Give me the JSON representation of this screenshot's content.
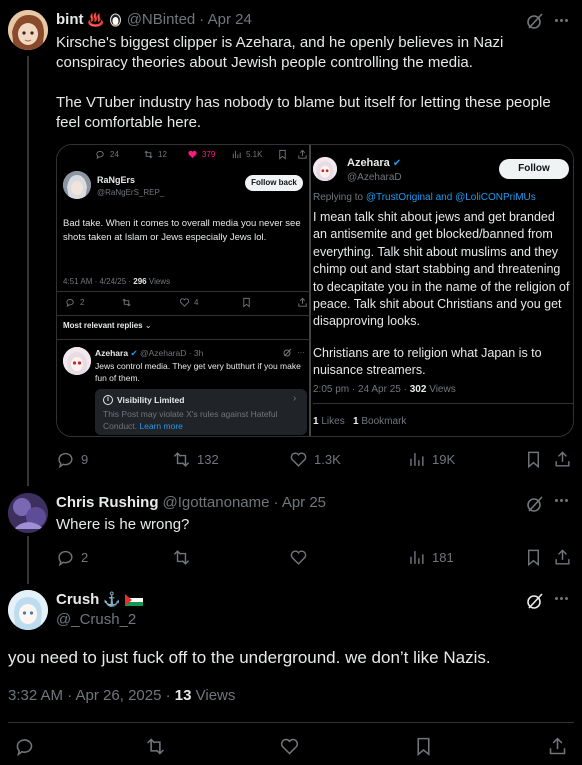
{
  "tweet1": {
    "display_name": "bint",
    "emoji": "♨️",
    "handle": "@NBinted",
    "date": "· Apr 24",
    "text_p1": "Kirsche's biggest clipper is Azehara, and he openly believes in Nazi conspiracy theories about Jewish people controlling the media.",
    "text_p2": "The VTuber industry has nobody to blame but itself for letting these people feel comfortable here.",
    "replies": "9",
    "reposts": "132",
    "likes": "1.3K",
    "views": "19K"
  },
  "embed_left": {
    "top_stats": {
      "replies": "24",
      "reposts": "12",
      "likes": "379",
      "views": "5.1K"
    },
    "name": "RaNgErs",
    "handle": "@RaNgErS_REP_",
    "follow_back": "Follow back",
    "text": "Bad take. When it comes to overall media you never see shots taken at Islam or Jews especially Jews lol.",
    "time": "4:51 AM · 4/24/25 ·",
    "views": "296",
    "views_label": "Views",
    "replies": "2",
    "likes": "4",
    "relevant": "Most relevant replies",
    "reply_name": "Azehara",
    "reply_handle": "@AzeharaD · 3h",
    "reply_text": "Jews control media.  They get very butthurt if you make fun of them.",
    "visibility_title": "Visibility Limited",
    "visibility_text": "This Post may violate X's rules against Hateful Conduct.",
    "learn_more": "Learn more"
  },
  "embed_right": {
    "name": "Azehara",
    "handle": "@AzeharaD",
    "follow": "Follow",
    "replying_prefix": "Replying to",
    "replying_to": "@TrustOriginal and @LoliCONPriMUs",
    "text1": "I mean talk shit about jews and get branded an antisemite and get blocked/banned from everything.  Talk shit about muslims and they chimp out and start stabbing and threatening to decapitate you in the name of the religion of peace.  Talk shit about Christians and you get disapproving looks.",
    "text2": "Christians are to religion what Japan is to nuisance streamers.",
    "time": "2:05 pm · 24 Apr 25 ·",
    "views": "302",
    "views_label": "Views",
    "likes_count": "1",
    "likes_label": "Likes",
    "bookmarks_count": "1",
    "bookmarks_label": "Bookmark"
  },
  "tweet2": {
    "display_name": "Chris Rushing",
    "handle": "@Igottanoname",
    "date": "· Apr 25",
    "text": "Where is he wrong?",
    "replies": "2",
    "views": "181"
  },
  "tweet3": {
    "display_name": "Crush",
    "handle": "@_Crush_2",
    "text": "you need to just fuck off to the underground. we don’t like Nazis.",
    "time": "3:32 AM · Apr 26, 2025 ·",
    "views": "13",
    "views_label": "Views"
  },
  "colors": {
    "background": "#000000",
    "text": "#e7e9ea",
    "muted": "#71767b",
    "accent": "#1d9bf0",
    "border": "#2f3336"
  }
}
